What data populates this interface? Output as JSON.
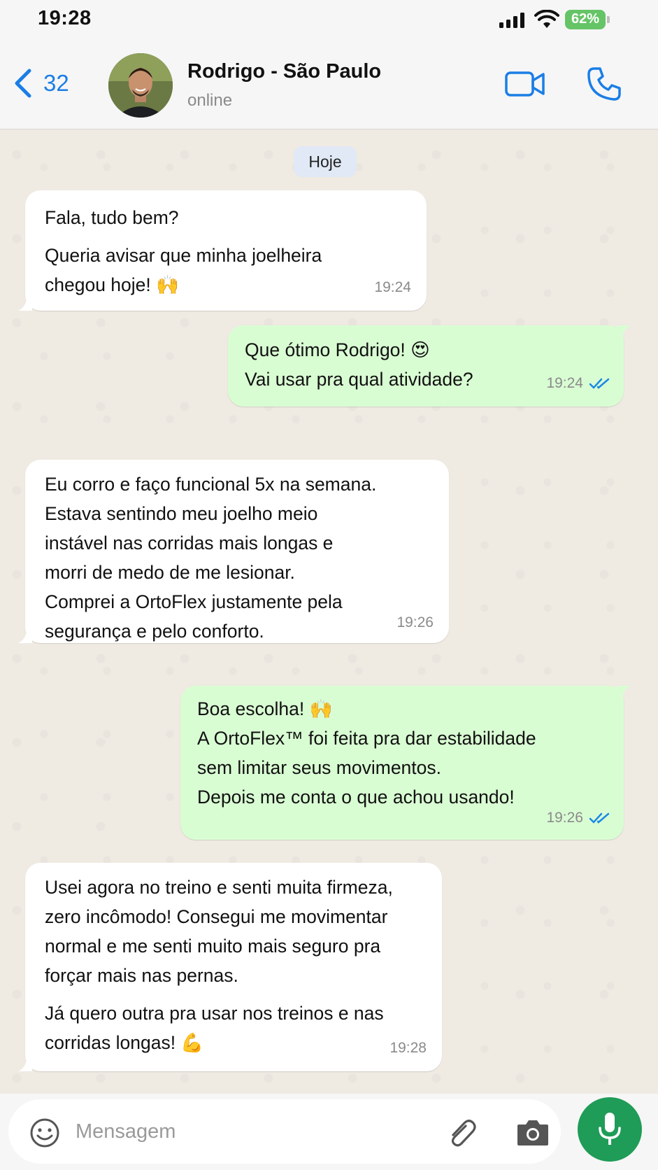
{
  "status_bar": {
    "time": "19:28",
    "battery": "62%"
  },
  "header": {
    "back_count": "32",
    "contact_name": "Rodrigo - São Paulo",
    "contact_status": "online"
  },
  "chat": {
    "day_label": "Hoje",
    "messages": [
      {
        "direction": "in",
        "lines": [
          "Fala, tudo bem?",
          "",
          "Queria avisar que minha joelheira",
          "chegou hoje! 🙌"
        ],
        "time": "19:24"
      },
      {
        "direction": "out",
        "lines": [
          "Que ótimo Rodrigo! 😍",
          "Vai usar pra qual atividade?"
        ],
        "time": "19:24",
        "read": true
      },
      {
        "direction": "in",
        "lines": [
          "Eu corro e faço funcional 5x na semana.",
          "Estava sentindo meu joelho meio",
          "instável nas corridas mais longas e",
          "morri de medo de me lesionar.",
          "Comprei a OrtoFlex justamente pela",
          "segurança e pelo conforto."
        ],
        "time": "19:26"
      },
      {
        "direction": "out",
        "lines": [
          "Boa escolha! 🙌",
          "A OrtoFlex™ foi feita pra dar estabilidade",
          "sem limitar seus movimentos.",
          "Depois me conta o que achou usando!"
        ],
        "time": "19:26",
        "read": true
      },
      {
        "direction": "in",
        "lines": [
          "Usei agora no treino e senti muita firmeza,",
          "zero incômodo! Consegui me movimentar",
          "normal e me senti muito mais seguro pra",
          "forçar mais nas pernas.",
          "",
          "Já quero outra pra usar nos treinos e nas",
          "corridas longas! 💪"
        ],
        "time": "19:28"
      }
    ]
  },
  "input": {
    "placeholder": "Mensagem"
  },
  "colors": {
    "accent": "#1a7ee6",
    "outgoing_bubble": "#d9fdd3",
    "incoming_bubble": "#ffffff",
    "mic_button": "#1f9c57",
    "battery": "#65c466"
  },
  "icons": {
    "back": "chevron-left-icon",
    "video": "video-camera-icon",
    "call": "phone-icon",
    "emoji": "smiley-icon",
    "attach": "paperclip-icon",
    "camera": "camera-icon",
    "mic": "microphone-icon"
  }
}
